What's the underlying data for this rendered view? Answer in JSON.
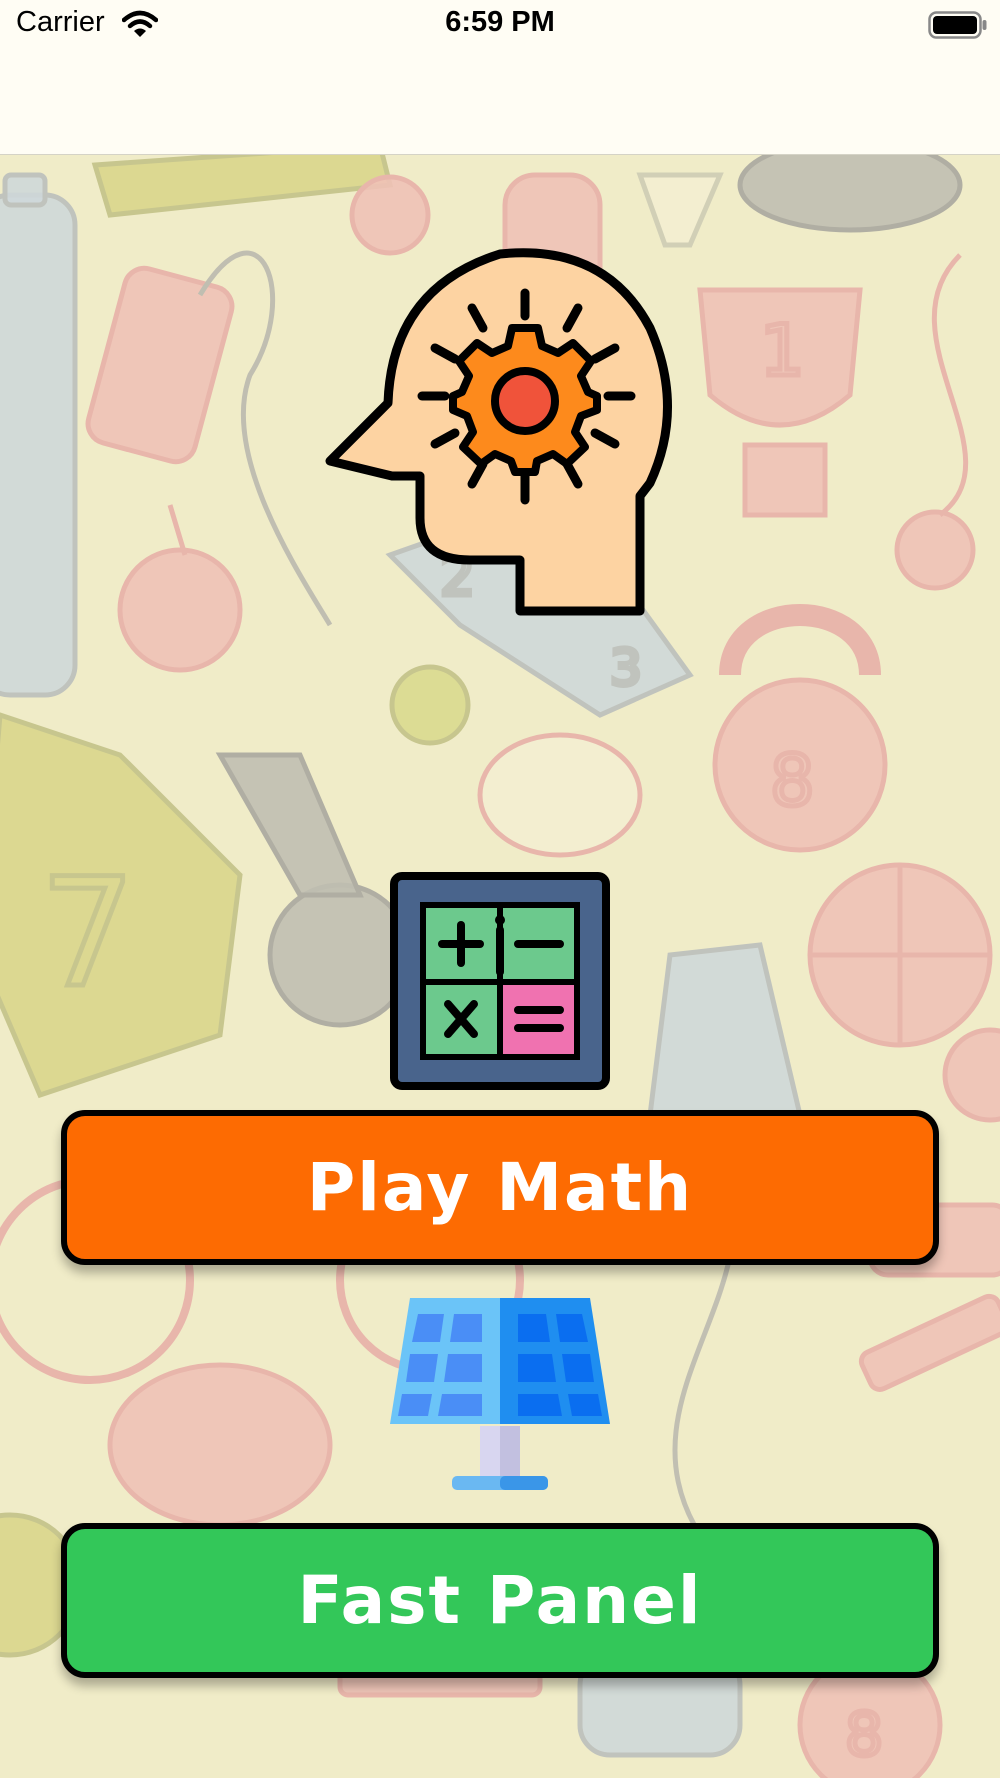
{
  "status_bar": {
    "carrier": "Carrier",
    "time": "6:59 PM",
    "wifi_icon": "wifi-icon",
    "battery_icon": "battery-icon"
  },
  "main": {
    "logo_icon": "head-with-gear-icon",
    "play_math": {
      "icon": "calculator-icon",
      "label": "Play Math",
      "color": "#fd6b02"
    },
    "fast_panel": {
      "icon": "solar-panel-icon",
      "label": "Fast Panel",
      "color": "#33c759"
    }
  },
  "colors": {
    "background": "#f0ecc8",
    "topbar": "#fffdf4"
  }
}
